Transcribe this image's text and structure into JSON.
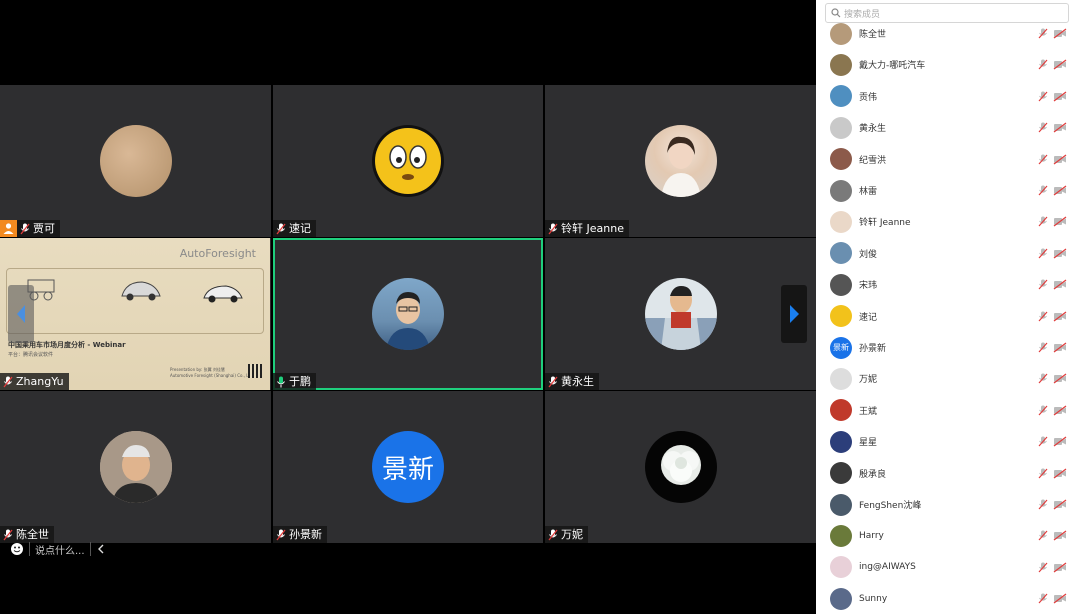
{
  "tiles": [
    {
      "name": "贾可",
      "host": true
    },
    {
      "name": "速记"
    },
    {
      "name": "铃轩 Jeanne"
    },
    {
      "name": "ZhangYu",
      "sharing": true
    },
    {
      "name": "于鹏",
      "active": true
    },
    {
      "name": "黄永生"
    },
    {
      "name": "陈全世"
    },
    {
      "name": "孙景新",
      "avatar_text": "景新"
    },
    {
      "name": "万妮"
    }
  ],
  "slide": {
    "brand": "AutoForesight",
    "title": "中国乘用车市场月度分析 - Webinar",
    "subtitle": "平台：腾讯会议软件",
    "footer_1": "Presentation by: 张翼 刘佳慧",
    "footer_2": "Automotive Foresight (Shanghai) Co., Ltd."
  },
  "chat": {
    "placeholder": "说点什么..."
  },
  "sidebar": {
    "search_placeholder": "搜索成员",
    "members": [
      {
        "name": "陈全世",
        "color": "#b59a7a"
      },
      {
        "name": "戴大力-哪吒汽车",
        "color": "#8a7650"
      },
      {
        "name": "贡伟",
        "color": "#4f8fc0"
      },
      {
        "name": "黄永生",
        "color": "#c9c9c9"
      },
      {
        "name": "纪雪洪",
        "color": "#8c5a4a"
      },
      {
        "name": "林雷",
        "color": "#7a7a7a"
      },
      {
        "name": "铃轩 Jeanne",
        "color": "#ead8c8"
      },
      {
        "name": "刘俊",
        "color": "#6a8fb0"
      },
      {
        "name": "宋玮",
        "color": "#555555"
      },
      {
        "name": "速记",
        "color": "#f2c21b"
      },
      {
        "name": "孙景新",
        "color": "#1a73e8",
        "text": "景新"
      },
      {
        "name": "万妮",
        "color": "#dddddd"
      },
      {
        "name": "王斌",
        "color": "#c0392b"
      },
      {
        "name": "星星",
        "color": "#2c3e7a"
      },
      {
        "name": "殷承良",
        "color": "#3a3a3a"
      },
      {
        "name": "FengShen沈峰",
        "color": "#4a5a6a"
      },
      {
        "name": "Harry",
        "color": "#6a7a3a"
      },
      {
        "name": "ing@AIWAYS",
        "color": "#e8d0d8"
      },
      {
        "name": "Sunny",
        "color": "#5a6a8a"
      }
    ]
  }
}
